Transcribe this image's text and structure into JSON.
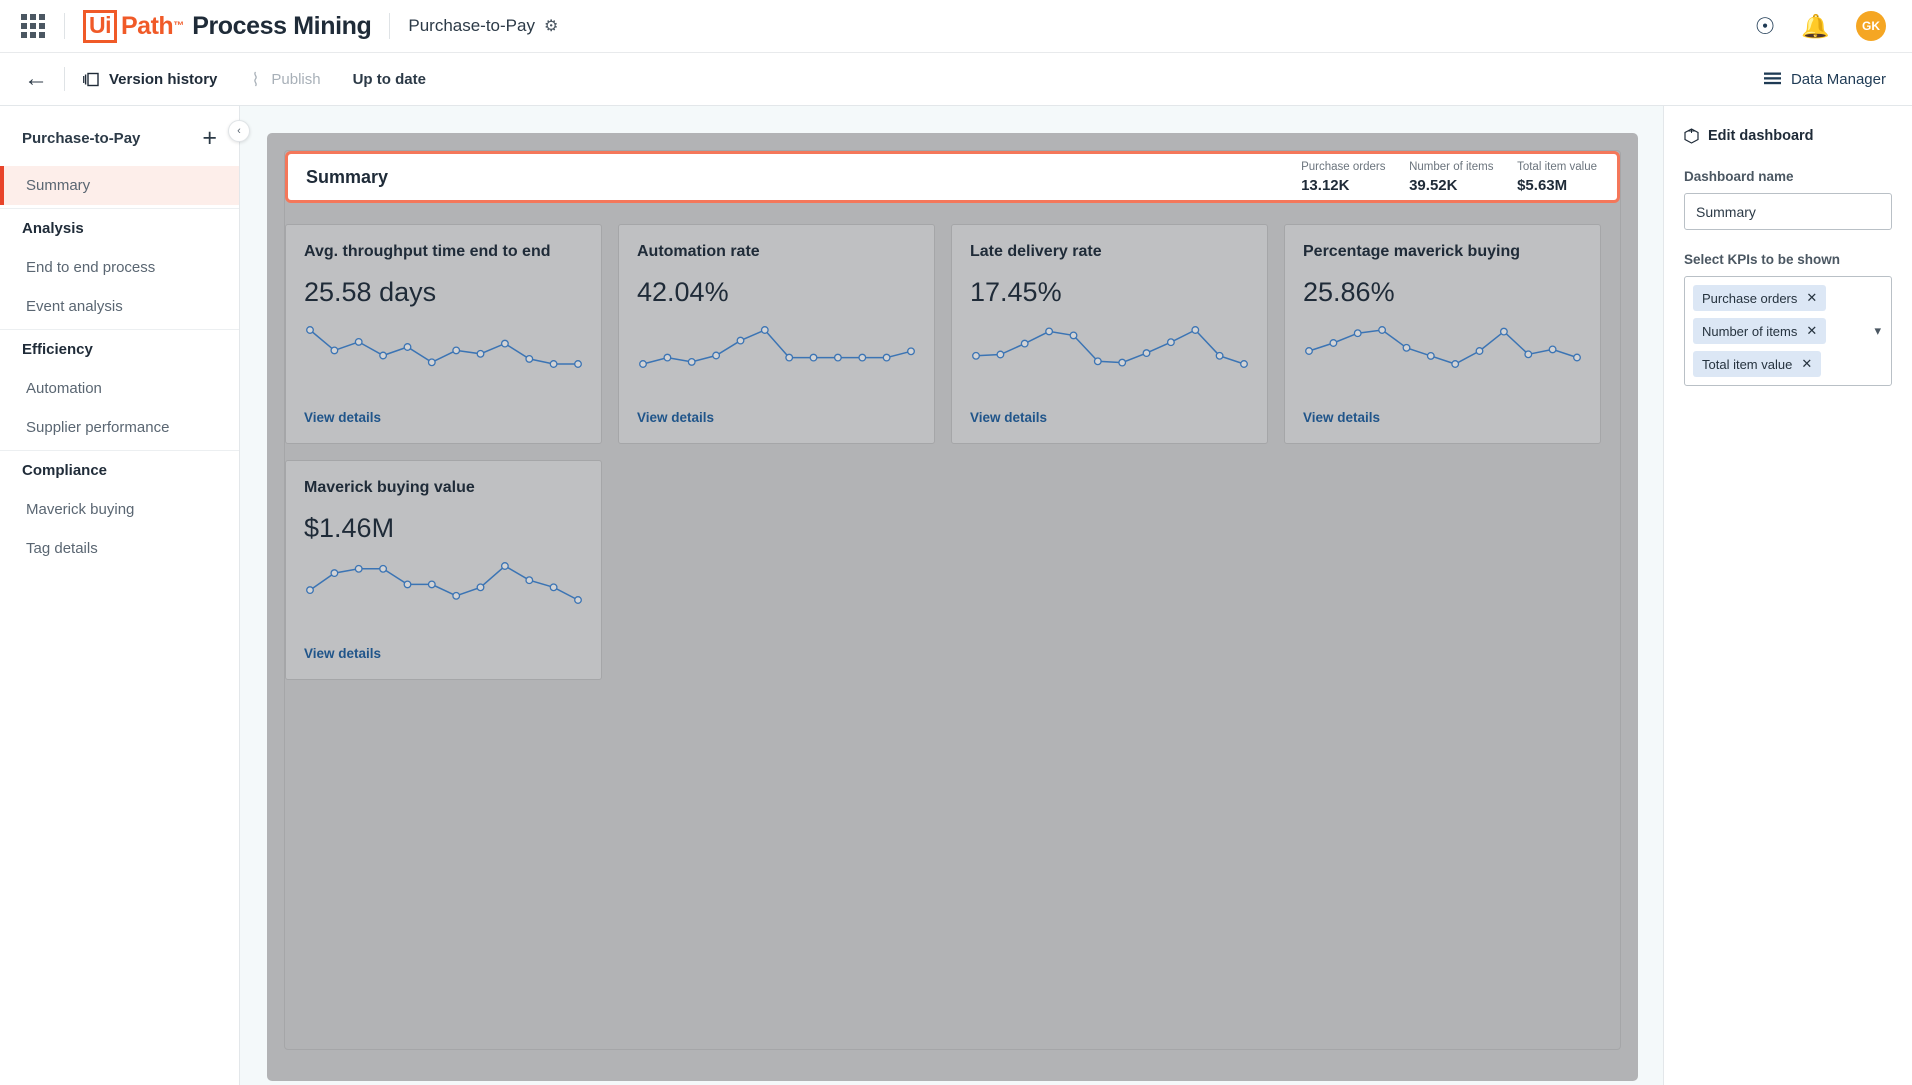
{
  "topbar": {
    "apps_icon": "apps-grid-icon",
    "brand_ui": "Ui",
    "brand_path": "Path",
    "brand_tm": "™",
    "brand_product": "Process Mining",
    "project_name": "Purchase-to-Pay",
    "gear_icon": "gear-icon",
    "help_icon": "help-circle-icon",
    "bell_icon": "bell-icon",
    "avatar_initials": "GK"
  },
  "toolbar": {
    "back_icon": "back-arrow-icon",
    "version_history_icon": "version-history-icon",
    "version_history": "Version history",
    "publish_icon": "publish-icon",
    "publish": "Publish",
    "status": "Up to date",
    "data_manager_icon": "list-icon",
    "data_manager": "Data Manager"
  },
  "sidebar": {
    "title": "Purchase-to-Pay",
    "add_icon": "plus-icon",
    "collapse_icon": "chevron-left-icon",
    "items": [
      {
        "label": "Summary",
        "type": "item",
        "active": true
      },
      {
        "label": "Analysis",
        "type": "group"
      },
      {
        "label": "End to end process",
        "type": "item"
      },
      {
        "label": "Event analysis",
        "type": "item"
      },
      {
        "label": "Efficiency",
        "type": "group"
      },
      {
        "label": "Automation",
        "type": "item"
      },
      {
        "label": "Supplier performance",
        "type": "item"
      },
      {
        "label": "Compliance",
        "type": "group"
      },
      {
        "label": "Maverick buying",
        "type": "item"
      },
      {
        "label": "Tag details",
        "type": "item"
      }
    ]
  },
  "dashboard": {
    "header_title": "Summary",
    "header_kpis": [
      {
        "label": "Purchase orders",
        "value": "13.12K"
      },
      {
        "label": "Number of items",
        "value": "39.52K"
      },
      {
        "label": "Total item value",
        "value": "$5.63M"
      }
    ],
    "view_details_label": "View details",
    "cards": [
      {
        "title": "Avg. throughput time end to end",
        "value": "25.58 days",
        "link": "View details",
        "sparkline": [
          60,
          48,
          53,
          45,
          50,
          41,
          48,
          46,
          52,
          43,
          40,
          40
        ]
      },
      {
        "title": "Automation rate",
        "value": "42.04%",
        "link": "View details",
        "sparkline": [
          44,
          47,
          45,
          48,
          55,
          60,
          47,
          47,
          47,
          47,
          47,
          50
        ]
      },
      {
        "title": "Late delivery rate",
        "value": "17.45%",
        "link": "View details",
        "sparkline": [
          38,
          39,
          47,
          56,
          53,
          34,
          33,
          40,
          48,
          57,
          38,
          32
        ]
      },
      {
        "title": "Percentage maverick buying",
        "value": "25.86%",
        "link": "View details",
        "sparkline": [
          42,
          47,
          53,
          55,
          44,
          39,
          34,
          42,
          54,
          40,
          43,
          38
        ]
      },
      {
        "title": "Maverick buying value",
        "value": "$1.46M",
        "link": "View details",
        "sparkline": [
          40,
          52,
          55,
          55,
          44,
          44,
          36,
          42,
          57,
          47,
          42,
          33
        ]
      }
    ]
  },
  "right_panel": {
    "header_icon": "edit-dashboard-icon",
    "header": "Edit dashboard",
    "name_label": "Dashboard name",
    "name_value": "Summary",
    "name_placeholder": "Dashboard name",
    "kpi_label": "Select KPIs to be shown",
    "chips": [
      {
        "label": "Purchase orders",
        "remove_icon": "close-icon"
      },
      {
        "label": "Number of items",
        "remove_icon": "close-icon"
      },
      {
        "label": "Total item value",
        "remove_icon": "close-icon"
      }
    ],
    "caret_icon": "chevron-down-icon"
  },
  "colors": {
    "brand_orange": "#f05a28",
    "accent_border": "#f4775a",
    "active_nav_bg": "#fdeeea",
    "active_nav_bar": "#e8442a",
    "link_blue": "#20558a",
    "spark_line": "#3b74b4",
    "canvas_bg": "#f4f9fa",
    "panel_gray": "#b2b3b5",
    "card_gray": "#bfc0c2",
    "avatar_bg": "#f5a623",
    "chip_bg": "#dce7f5"
  }
}
